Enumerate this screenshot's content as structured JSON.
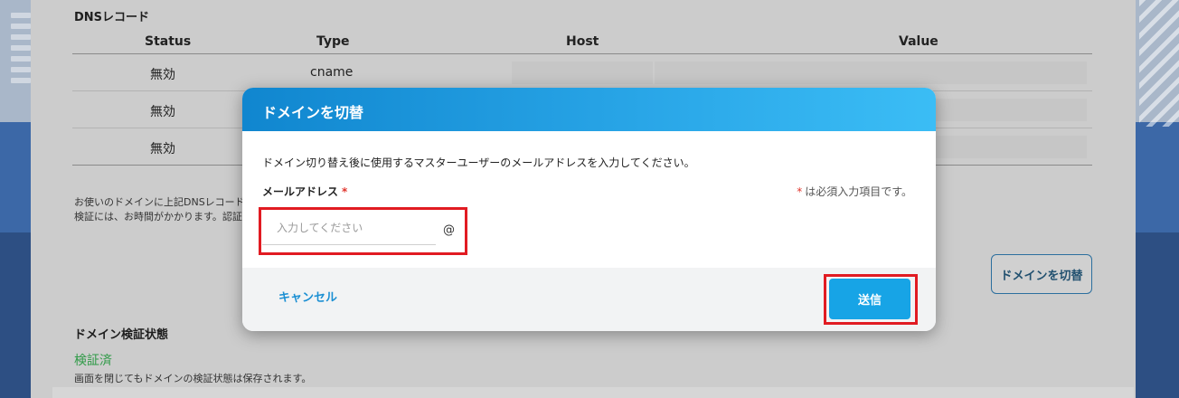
{
  "background": {
    "section_title": "DNSレコード",
    "table": {
      "headers": [
        "Status",
        "Type",
        "Host",
        "Value"
      ],
      "rows": [
        {
          "status": "無効",
          "type": "cname"
        },
        {
          "status": "無効",
          "type": ""
        },
        {
          "status": "無効",
          "type": ""
        }
      ]
    },
    "note_line1": "お使いのドメインに上記DNSレコードをもと",
    "note_line2": "検証には、お時間がかかります。認証をお",
    "switch_button": "ドメインを切替",
    "verify_title": "ドメイン検証状態",
    "verify_status": "検証済",
    "verify_note": "画面を閉じてもドメインの検証状態は保存されます。"
  },
  "modal": {
    "title": "ドメインを切替",
    "description": "ドメイン切り替え後に使用するマスターユーザーのメールアドレスを入力してください。",
    "field_label": "メールアドレス",
    "required_mark": "*",
    "required_note": "は必須入力項目です。",
    "email_placeholder": "入力してください",
    "email_value": "",
    "email_suffix": "@",
    "cancel_label": "キャンセル",
    "submit_label": "送信"
  },
  "colors": {
    "header_gradient_start": "#1086cf",
    "header_gradient_end": "#3bbdf5",
    "submit_button": "#17a4e6",
    "cancel_text": "#1b8fd3",
    "required_mark": "#e0352c",
    "highlight": "#e11b22",
    "verified": "#2f9a47"
  }
}
